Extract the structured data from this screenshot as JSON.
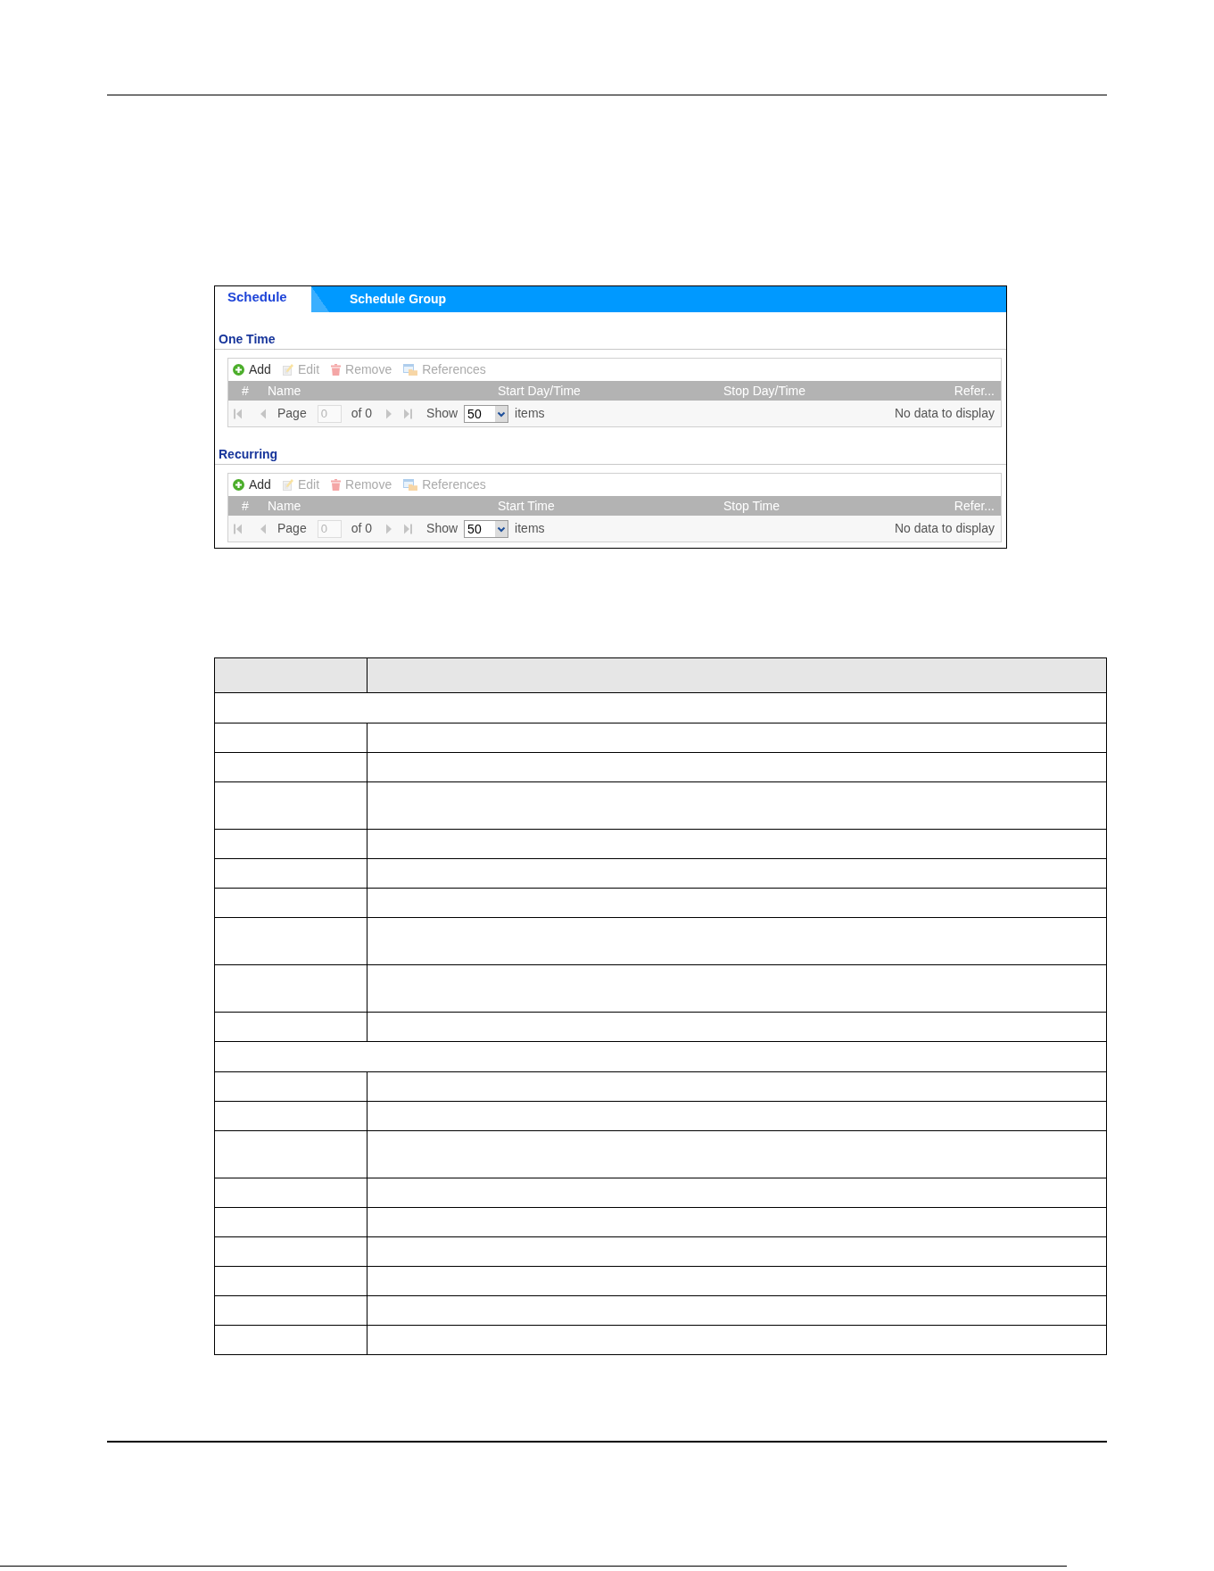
{
  "tabs": [
    {
      "label": "Schedule",
      "selected": true
    },
    {
      "label": "Schedule Group",
      "selected": false
    }
  ],
  "sections": [
    {
      "title": "One Time",
      "toolbar": [
        {
          "kind": "add",
          "label": "Add",
          "disabled": false
        },
        {
          "kind": "edit",
          "label": "Edit",
          "disabled": true
        },
        {
          "kind": "remove",
          "label": "Remove",
          "disabled": true
        },
        {
          "kind": "references",
          "label": "References",
          "disabled": true
        }
      ],
      "columns": [
        "#",
        "Name",
        "Start Day/Time",
        "Stop Day/Time",
        "Refer..."
      ],
      "pager": {
        "back_buttons": [
          {
            "kind": "first",
            "disabled": true
          },
          {
            "kind": "previous",
            "disabled": true
          }
        ],
        "page_label": "Page",
        "page_field": {
          "value": "0",
          "disabled": true
        },
        "page_count": "of 0",
        "forward_buttons": [
          {
            "kind": "next",
            "disabled": true
          },
          {
            "kind": "last",
            "disabled": true
          }
        ],
        "show_label": "Show",
        "show_select": {
          "value": "50"
        },
        "items_label": "items",
        "status": "No data to display"
      }
    },
    {
      "title": "Recurring",
      "toolbar": [
        {
          "kind": "add",
          "label": "Add",
          "disabled": false
        },
        {
          "kind": "edit",
          "label": "Edit",
          "disabled": true
        },
        {
          "kind": "remove",
          "label": "Remove",
          "disabled": true
        },
        {
          "kind": "references",
          "label": "References",
          "disabled": true
        }
      ],
      "columns": [
        "#",
        "Name",
        "Start Time",
        "Stop Time",
        "Refer..."
      ],
      "pager": {
        "back_buttons": [
          {
            "kind": "first",
            "disabled": true
          },
          {
            "kind": "previous",
            "disabled": true
          }
        ],
        "page_label": "Page",
        "page_field": {
          "value": "0",
          "disabled": true
        },
        "page_count": "of 0",
        "forward_buttons": [
          {
            "kind": "next",
            "disabled": true
          },
          {
            "kind": "last",
            "disabled": true
          }
        ],
        "show_label": "Show",
        "show_select": {
          "value": "50"
        },
        "items_label": "items",
        "status": "No data to display"
      }
    }
  ],
  "description_table": {
    "rows": [
      {
        "kind": "header"
      },
      {
        "kind": "section"
      },
      {
        "kind": "single"
      },
      {
        "kind": "single"
      },
      {
        "kind": "double"
      },
      {
        "kind": "single"
      },
      {
        "kind": "single"
      },
      {
        "kind": "single"
      },
      {
        "kind": "double"
      },
      {
        "kind": "double"
      },
      {
        "kind": "single"
      },
      {
        "kind": "section"
      },
      {
        "kind": "single"
      },
      {
        "kind": "single"
      },
      {
        "kind": "double"
      },
      {
        "kind": "single"
      },
      {
        "kind": "single"
      },
      {
        "kind": "single"
      },
      {
        "kind": "single"
      },
      {
        "kind": "single"
      },
      {
        "kind": "single"
      }
    ]
  }
}
